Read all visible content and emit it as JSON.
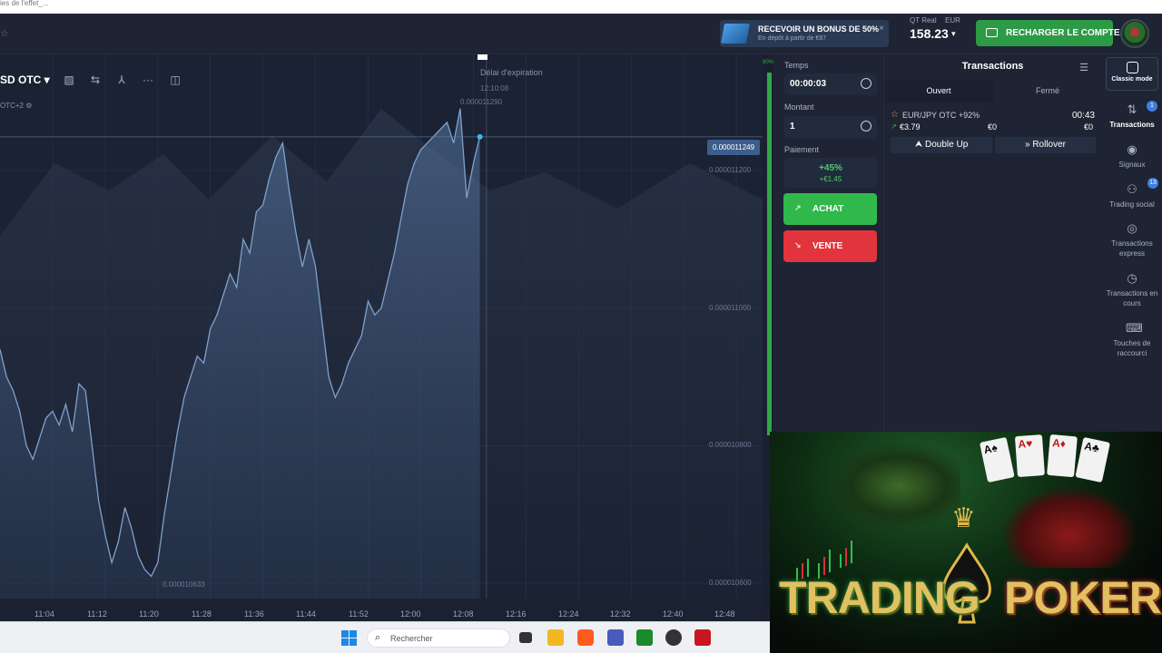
{
  "browser": {
    "tab_text": "ies de l'effet_..."
  },
  "header": {
    "bonus_title": "RECEVOIR UN BONUS DE 50%",
    "bonus_sub": "En dépôt à partir de €87",
    "bonus_close": "×",
    "account_label": "QT Real",
    "account_currency": "EUR",
    "balance": "158.23",
    "recharge_label": "RECHARGER LE COMPTE"
  },
  "chart": {
    "asset_name": "SD OTC",
    "asset_sub": "OTC+2",
    "expiry_label": "Délai d'expiration",
    "expiry_time": "12:10:08",
    "max_label": "0.000011290",
    "min_label": "0.000010633",
    "current_price": "0.000011249",
    "green_top": "80%",
    "y_ticks": [
      {
        "label": "0.000011200",
        "value": 1.12e-05
      },
      {
        "label": "0.000011000",
        "value": 1.1e-05
      },
      {
        "label": "0.000010800",
        "value": 1.08e-05
      },
      {
        "label": "0.000010600",
        "value": 1.06e-05
      }
    ],
    "x_ticks": [
      "11:04",
      "11:12",
      "11:20",
      "11:28",
      "11:36",
      "11:44",
      "11:52",
      "12:00",
      "12:08",
      "12:16",
      "12:24",
      "12:32",
      "12:40",
      "12:48"
    ]
  },
  "chart_data": {
    "type": "area",
    "title": "",
    "xlabel": "",
    "ylabel": "",
    "x_range": [
      "10:56",
      "12:52"
    ],
    "ylim": [
      1.056e-05,
      1.133e-05
    ],
    "series": [
      {
        "values": [
          [
            "10:56",
            1.094e-05
          ],
          [
            "10:57",
            1.09e-05
          ],
          [
            "10:58",
            1.088e-05
          ],
          [
            "10:59",
            1.085e-05
          ],
          [
            "11:00",
            1.08e-05
          ],
          [
            "11:01",
            1.078e-05
          ],
          [
            "11:02",
            1.081e-05
          ],
          [
            "11:03",
            1.084e-05
          ],
          [
            "11:04",
            1.085e-05
          ],
          [
            "11:05",
            1.083e-05
          ],
          [
            "11:06",
            1.086e-05
          ],
          [
            "11:07",
            1.082e-05
          ],
          [
            "11:08",
            1.089e-05
          ],
          [
            "11:09",
            1.088e-05
          ],
          [
            "11:10",
            1.08e-05
          ],
          [
            "11:11",
            1.072e-05
          ],
          [
            "11:12",
            1.067e-05
          ],
          [
            "11:13",
            1.063e-05
          ],
          [
            "11:14",
            1.066e-05
          ],
          [
            "11:15",
            1.071e-05
          ],
          [
            "11:16",
            1.068e-05
          ],
          [
            "11:17",
            1.064e-05
          ],
          [
            "11:18",
            1.062e-05
          ],
          [
            "11:19",
            1.061e-05
          ],
          [
            "11:20",
            1.063e-05
          ],
          [
            "11:21",
            1.07e-05
          ],
          [
            "11:22",
            1.076e-05
          ],
          [
            "11:23",
            1.082e-05
          ],
          [
            "11:24",
            1.087e-05
          ],
          [
            "11:25",
            1.09e-05
          ],
          [
            "11:26",
            1.093e-05
          ],
          [
            "11:27",
            1.092e-05
          ],
          [
            "11:28",
            1.097e-05
          ],
          [
            "11:29",
            1.099e-05
          ],
          [
            "11:30",
            1.102e-05
          ],
          [
            "11:31",
            1.105e-05
          ],
          [
            "11:32",
            1.103e-05
          ],
          [
            "11:33",
            1.11e-05
          ],
          [
            "11:34",
            1.108e-05
          ],
          [
            "11:35",
            1.114e-05
          ],
          [
            "11:36",
            1.115e-05
          ],
          [
            "11:37",
            1.119e-05
          ],
          [
            "11:38",
            1.122e-05
          ],
          [
            "11:39",
            1.124e-05
          ],
          [
            "11:40",
            1.117e-05
          ],
          [
            "11:41",
            1.111e-05
          ],
          [
            "11:42",
            1.106e-05
          ],
          [
            "11:43",
            1.11e-05
          ],
          [
            "11:44",
            1.106e-05
          ],
          [
            "11:45",
            1.098e-05
          ],
          [
            "11:46",
            1.09e-05
          ],
          [
            "11:47",
            1.087e-05
          ],
          [
            "11:48",
            1.089e-05
          ],
          [
            "11:49",
            1.092e-05
          ],
          [
            "11:50",
            1.094e-05
          ],
          [
            "11:51",
            1.096e-05
          ],
          [
            "11:52",
            1.101e-05
          ],
          [
            "11:53",
            1.099e-05
          ],
          [
            "11:54",
            1.1e-05
          ],
          [
            "11:55",
            1.104e-05
          ],
          [
            "11:56",
            1.108e-05
          ],
          [
            "11:57",
            1.113e-05
          ],
          [
            "11:58",
            1.118e-05
          ],
          [
            "11:59",
            1.121e-05
          ],
          [
            "12:00",
            1.123e-05
          ],
          [
            "12:01",
            1.124e-05
          ],
          [
            "12:02",
            1.125e-05
          ],
          [
            "12:03",
            1.126e-05
          ],
          [
            "12:04",
            1.127e-05
          ],
          [
            "12:05",
            1.124e-05
          ],
          [
            "12:06",
            1.129e-05
          ],
          [
            "12:07",
            1.116e-05
          ],
          [
            "12:08",
            1.121e-05
          ],
          [
            "12:09",
            1.125e-05
          ]
        ]
      }
    ],
    "grid": true,
    "current_value": 1.1249e-05,
    "expiry_x": "12:10"
  },
  "trade_panel": {
    "time_label": "Temps",
    "time_value": "00:00:03",
    "amount_label": "Montant",
    "amount_value": "1",
    "payout_label": "Paiement",
    "payout_pct": "+45%",
    "payout_amt": "+€1.45",
    "buy_label": "ACHAT",
    "sell_label": "VENTE",
    "buy_color": "#31b84b",
    "sell_color": "#e2343c"
  },
  "transactions": {
    "title": "Transactions",
    "tab_open": "Ouvert",
    "tab_closed": "Fermé",
    "trade": {
      "pair": "EUR/JPY OTC +92%",
      "timer": "00:43",
      "amount": "€3.79",
      "mid": "€0",
      "end": "€0",
      "double_up": "Double Up",
      "rollover": "Rollover"
    }
  },
  "sidebar": {
    "classic": "Classic mode",
    "items": [
      {
        "label": "Transactions",
        "icon": "arrows-updown-icon",
        "badge": "1"
      },
      {
        "label": "Signaux",
        "icon": "signal-icon"
      },
      {
        "label": "Trading social",
        "icon": "users-icon",
        "badge": "13"
      },
      {
        "label": "Transactions express",
        "icon": "target-icon"
      },
      {
        "label": "Transactions en cours",
        "icon": "clock-icon"
      },
      {
        "label": "Touches de raccourci",
        "icon": "keyboard-icon"
      }
    ]
  },
  "taskbar": {
    "search_label": "Rechercher"
  },
  "overlay": {
    "title_left": "TRADING",
    "title_right": "POKER"
  }
}
